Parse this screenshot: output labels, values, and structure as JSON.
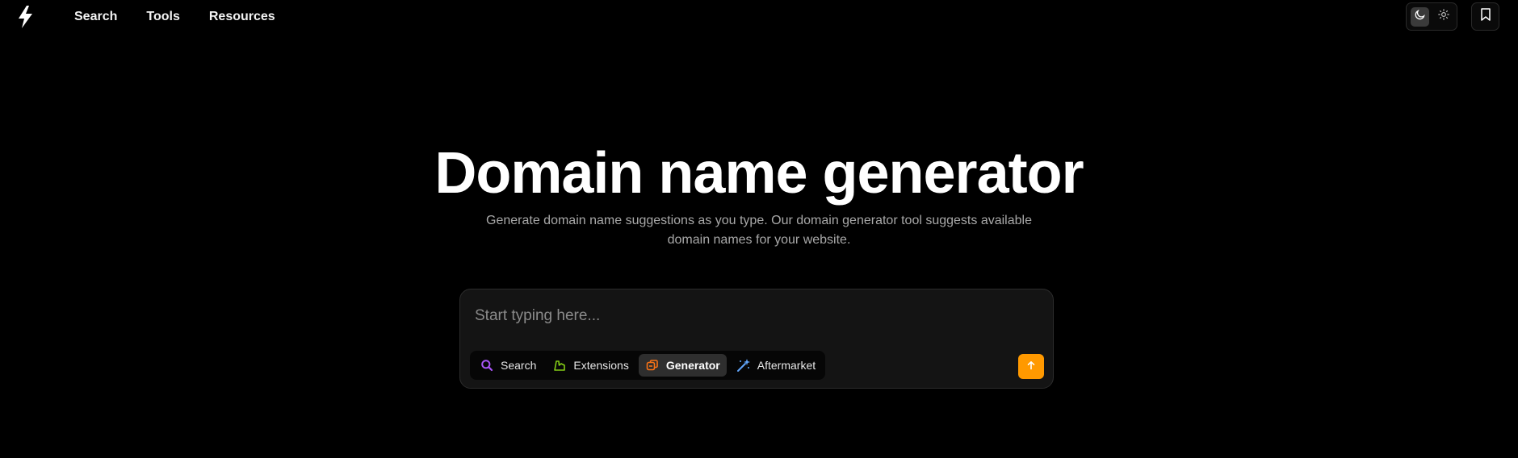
{
  "nav": {
    "logo_icon": "bolt-icon",
    "items": [
      {
        "label": "Search"
      },
      {
        "label": "Tools"
      },
      {
        "label": "Resources"
      }
    ]
  },
  "header_controls": {
    "theme": {
      "dark_icon": "moon-icon",
      "light_icon": "sun-icon",
      "active": "dark"
    },
    "bookmark_icon": "bookmark-icon"
  },
  "hero": {
    "title": "Domain name generator",
    "subtitle": "Generate domain name suggestions as you type. Our domain generator tool suggests available domain names for your website."
  },
  "search": {
    "placeholder": "Start typing here...",
    "value": "",
    "modes": [
      {
        "label": "Search",
        "icon": "magnifier-icon",
        "color": "#a855f7",
        "active": false
      },
      {
        "label": "Extensions",
        "icon": "extensions-icon",
        "color": "#84cc16",
        "active": false
      },
      {
        "label": "Generator",
        "icon": "generator-icon",
        "color": "#f97316",
        "active": true
      },
      {
        "label": "Aftermarket",
        "icon": "magic-wand-icon",
        "color": "#60a5fa",
        "active": false
      }
    ],
    "submit_icon": "arrow-up-icon",
    "submit_color": "#ff9900"
  }
}
